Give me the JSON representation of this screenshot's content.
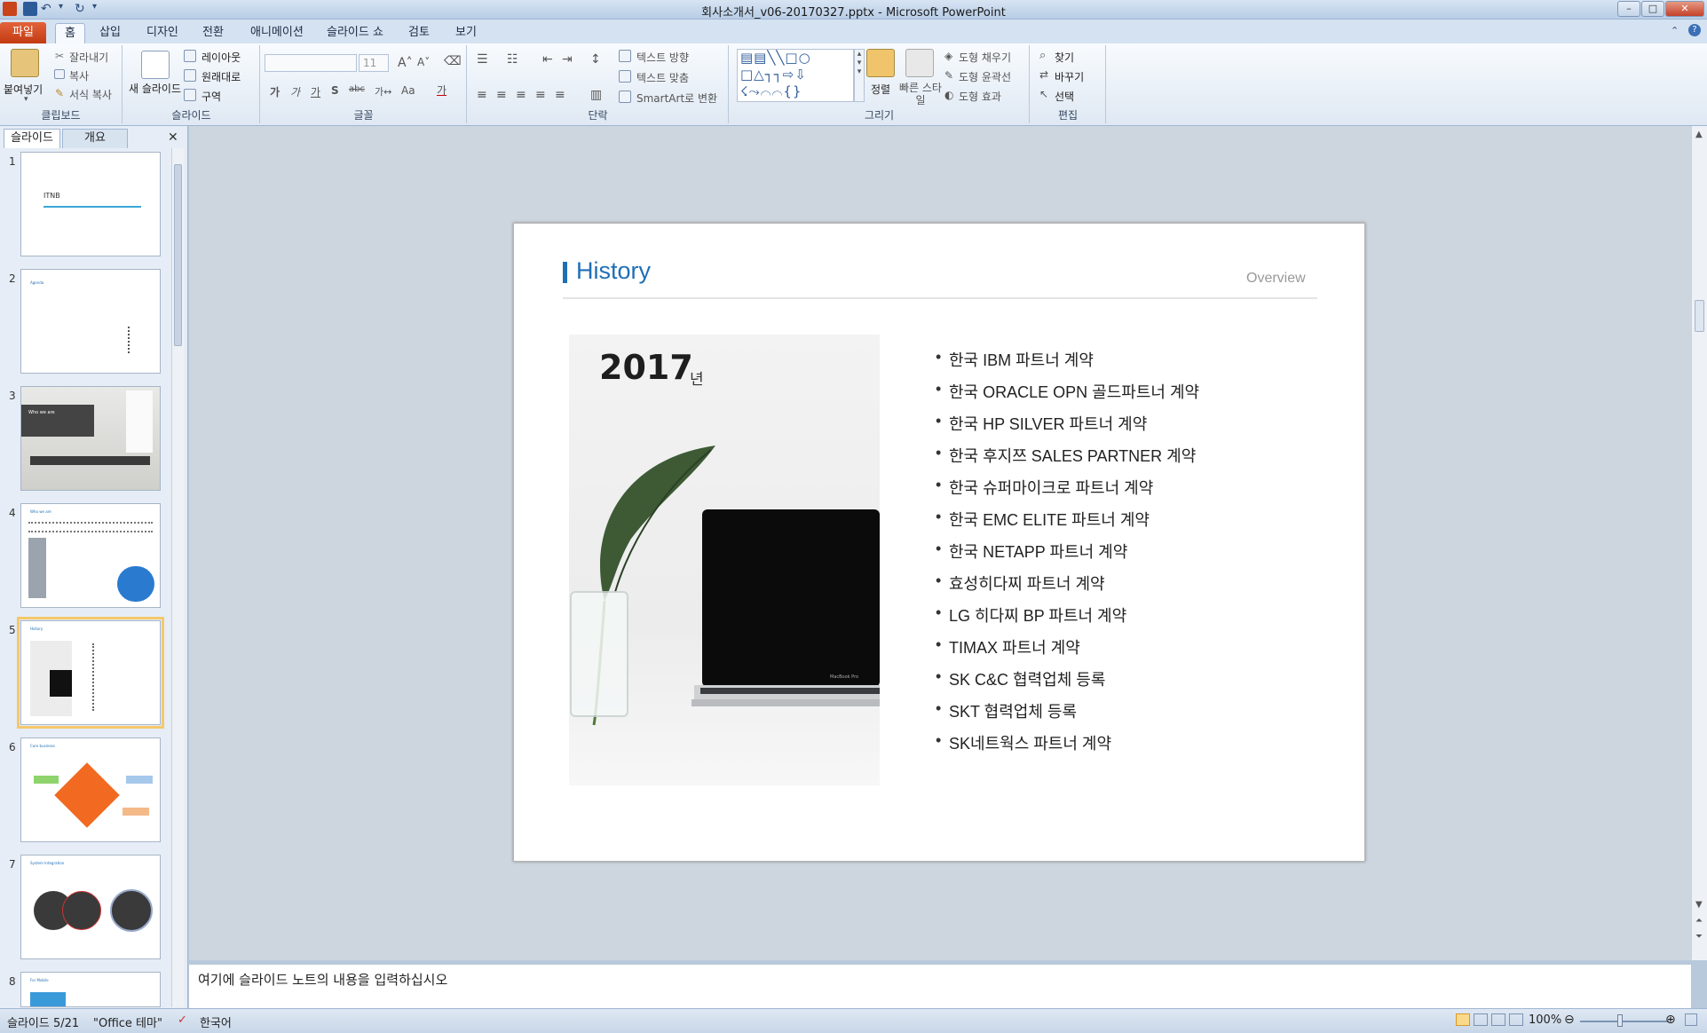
{
  "window": {
    "title": "회사소개서_v06-20170327.pptx  -  Microsoft PowerPoint"
  },
  "ribbon_tabs": [
    "파일",
    "홈",
    "삽입",
    "디자인",
    "전환",
    "애니메이션",
    "슬라이드 쇼",
    "검토",
    "보기"
  ],
  "ribbon": {
    "clipboard": {
      "paste": "붙여넣기",
      "cut": "잘라내기",
      "copy": "복사",
      "format_painter": "서식 복사",
      "label": "클립보드"
    },
    "slides": {
      "new_slide": "새 슬라이드",
      "layout": "레이아웃",
      "reset": "원래대로",
      "section": "구역",
      "label": "슬라이드"
    },
    "font": {
      "size": "11",
      "label": "글꼴",
      "bold": "가",
      "italic": "가",
      "underline": "가",
      "strike": "S",
      "spacing": "abc",
      "change_case": "Aa",
      "font_color": "가"
    },
    "paragraph": {
      "text_direction": "텍스트 방향",
      "align_text": "텍스트 맞춤",
      "smartart": "SmartArt로 변환",
      "label": "단락"
    },
    "drawing": {
      "arrange": "정렬",
      "quick_styles": "빠른 스타일",
      "shape_fill": "도형 채우기",
      "shape_outline": "도형 윤곽선",
      "shape_effects": "도형 효과",
      "label": "그리기"
    },
    "editing": {
      "find": "찾기",
      "replace": "바꾸기",
      "select": "선택",
      "label": "편집"
    }
  },
  "pane_tabs": {
    "slides": "슬라이드",
    "outline": "개요"
  },
  "thumbnails": [
    {
      "num": "1",
      "caption": "ITNB"
    },
    {
      "num": "2",
      "caption": "Agenda"
    },
    {
      "num": "3",
      "caption": "Who we are"
    },
    {
      "num": "4",
      "caption": "Who we are"
    },
    {
      "num": "5",
      "caption": "History"
    },
    {
      "num": "6",
      "caption": "Core business"
    },
    {
      "num": "7",
      "caption": "System Integration"
    },
    {
      "num": "8",
      "caption": "For Mobile"
    }
  ],
  "slide": {
    "title": "History",
    "section": "Overview",
    "year": "2017",
    "year_suffix": "년",
    "items": [
      "한국 IBM 파트너 계약",
      "한국 ORACLE OPN 골드파트너 계약",
      "한국 HP SILVER 파트너 계약",
      "한국 후지쯔 SALES PARTNER 계약",
      "한국 슈퍼마이크로 파트너 계약",
      "한국 EMC ELITE 파트너 계약",
      "한국 NETAPP 파트너 계약",
      "효성히다찌 파트너 계약",
      "LG 히다찌 BP 파트너 계약",
      "TIMAX 파트너 계약",
      "SK C&C 협력업체 등록",
      "SKT 협력업체 등록",
      "SK네트웍스 파트너 계약"
    ],
    "laptop_label": "MacBook Pro"
  },
  "notes": {
    "placeholder": "여기에 슬라이드 노트의 내용을 입력하십시오"
  },
  "status": {
    "slide": "슬라이드 5/21",
    "theme": "\"Office 테마\"",
    "language": "한국어",
    "zoom": "100%"
  },
  "colors": {
    "accent": "#1f6fb5",
    "file_tab": "#d04a1c"
  }
}
